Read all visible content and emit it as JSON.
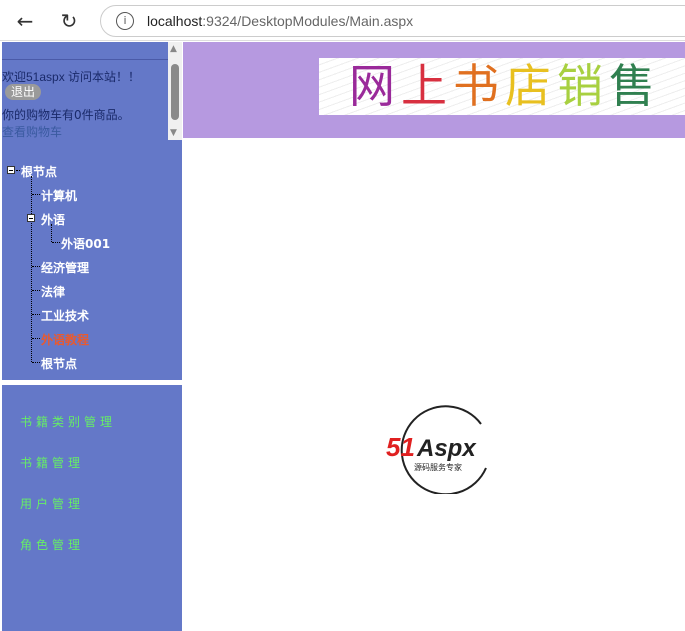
{
  "browser": {
    "url_host": "localhost",
    "url_path": ":9324/DesktopModules/Main.aspx",
    "back_icon": "arrow-left",
    "reload_icon": "reload"
  },
  "login": {
    "welcome": "欢迎51aspx 访问本站！！",
    "logout": "退出",
    "cart_status": "你的购物车有0件商品。",
    "view_cart": "查看购物车"
  },
  "tree": {
    "root": "根节点",
    "items": [
      "计算机",
      "外语",
      "外语001",
      "经济管理",
      "法律",
      "工业技术",
      "外语教程",
      "根节点"
    ]
  },
  "admin_menu": [
    "书籍类别管理",
    "书籍管理",
    "用户管理",
    "角色管理"
  ],
  "banner": {
    "chars": [
      "网",
      "上",
      "书",
      "店",
      "销",
      "售"
    ],
    "colors": [
      "#9a2a9a",
      "#d83040",
      "#e07020",
      "#e8c020",
      "#a8d040",
      "#308050"
    ]
  },
  "logo": {
    "brand_red": "51",
    "brand_black": "Aspx",
    "tagline": "源码服务专家"
  }
}
